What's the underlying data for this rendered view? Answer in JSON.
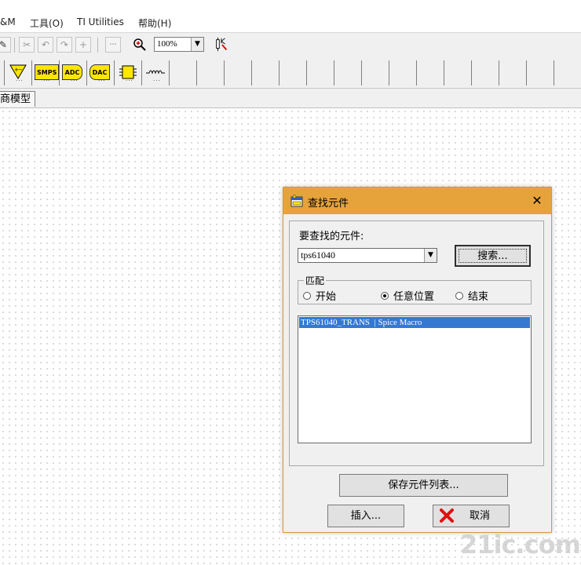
{
  "menubar": {
    "items": [
      "&M",
      "工具(O)",
      "TI Utilities",
      "帮助(H)"
    ]
  },
  "toolbar": {
    "zoom_value": "100%"
  },
  "palette": {
    "items": [
      "op-amp-icon",
      "SMPS",
      "ADC",
      "DAC",
      "chip-icon",
      "inductor-icon"
    ]
  },
  "tabs": {
    "active": "商模型"
  },
  "dialog": {
    "title": "查找元件",
    "find_label": "要查找的元件:",
    "search_value": "tps61040",
    "search_button": "搜索...",
    "match_group": {
      "title": "匹配",
      "options": [
        "开始",
        "任意位置",
        "结束"
      ],
      "selected": "任意位置"
    },
    "results": [
      "TPS61040_TRANS  | Spice Macro"
    ],
    "save_list_button": "保存元件列表...",
    "insert_button": "插入...",
    "cancel_button": "取消"
  },
  "watermark": "21ic.com",
  "colors": {
    "title_bar": "#e7a33b",
    "selection": "#3478d2",
    "palette_fill": "#ffe600"
  }
}
